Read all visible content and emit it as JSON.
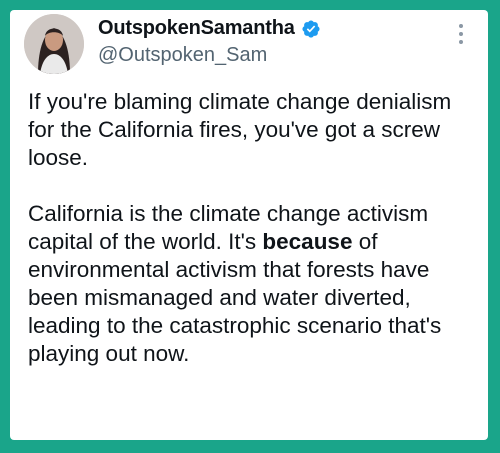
{
  "post": {
    "author": {
      "display_name": "OutspokenSamantha",
      "handle": "@Outspoken_Sam",
      "verified": true,
      "avatar_icon": "profile-photo",
      "badge_icon": "verified-badge-icon",
      "badge_color": "#1d9bf0"
    },
    "menu_icon": "more-vertical-icon",
    "paragraph_1": "If you're blaming climate change denialism for the California fires, you've got a screw loose.",
    "paragraph_2": {
      "before": "California is the climate change activism capital of the world. It's ",
      "emphasis": "because",
      "after": " of environmental activism that forests have been mismanaged and water diverted, leading to the catastrophic scenario that's playing out now."
    }
  },
  "colors": {
    "border": "#1aa58a",
    "text": "#0f1419",
    "secondary_text": "#536471"
  }
}
